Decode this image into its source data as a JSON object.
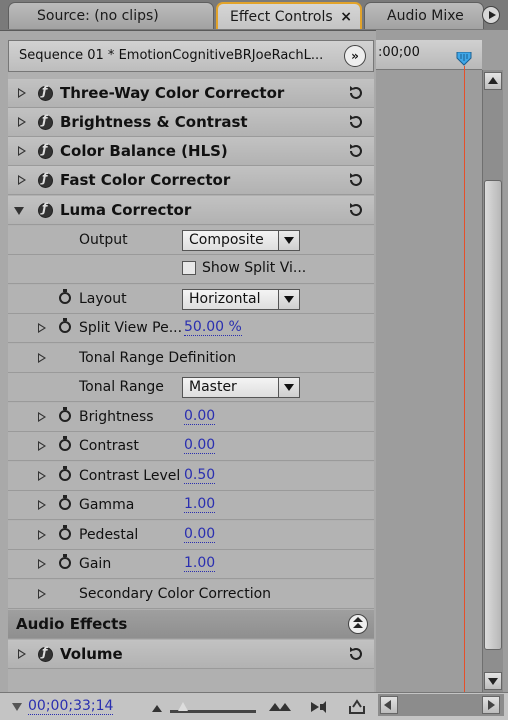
{
  "tabs": [
    {
      "label": "Source: (no clips)"
    },
    {
      "label": "Effect Controls",
      "close": "×"
    },
    {
      "label": "Audio Mixe"
    }
  ],
  "sequence": {
    "name": "Sequence 01 * EmotionCognitiveBRJoeRachL...",
    "nav_symbol": "»",
    "ruler_time": ":00;00"
  },
  "effects": [
    {
      "label": "Three-Way Color Corrector"
    },
    {
      "label": "Brightness & Contrast"
    },
    {
      "label": "Color Balance (HLS)"
    },
    {
      "label": "Fast Color Corrector"
    },
    {
      "label": "Luma Corrector"
    }
  ],
  "luma": {
    "output": {
      "label": "Output",
      "value": "Composite"
    },
    "split": {
      "label": "Show Split Vi..."
    },
    "layout": {
      "label": "Layout",
      "value": "Horizontal"
    },
    "split_view": {
      "label": "Split View Pe...",
      "value": "50.00 %"
    },
    "tonal_def": {
      "label": "Tonal Range Definition"
    },
    "tonal_range": {
      "label": "Tonal Range",
      "value": "Master"
    },
    "brightness": {
      "label": "Brightness",
      "value": "0.00"
    },
    "contrast": {
      "label": "Contrast",
      "value": "0.00"
    },
    "contrast_level": {
      "label": "Contrast Level",
      "value": "0.50"
    },
    "gamma": {
      "label": "Gamma",
      "value": "1.00"
    },
    "pedestal": {
      "label": "Pedestal",
      "value": "0.00"
    },
    "gain": {
      "label": "Gain",
      "value": "1.00"
    },
    "secondary": {
      "label": "Secondary Color Correction"
    }
  },
  "audio_section": {
    "label": "Audio Effects"
  },
  "volume": {
    "label": "Volume"
  },
  "footer": {
    "timecode": "00;00;33;14"
  },
  "colors": {
    "accent_tab_border": "#e2a32a",
    "playhead": "#e5502a",
    "value_link": "#2a2fb0"
  }
}
